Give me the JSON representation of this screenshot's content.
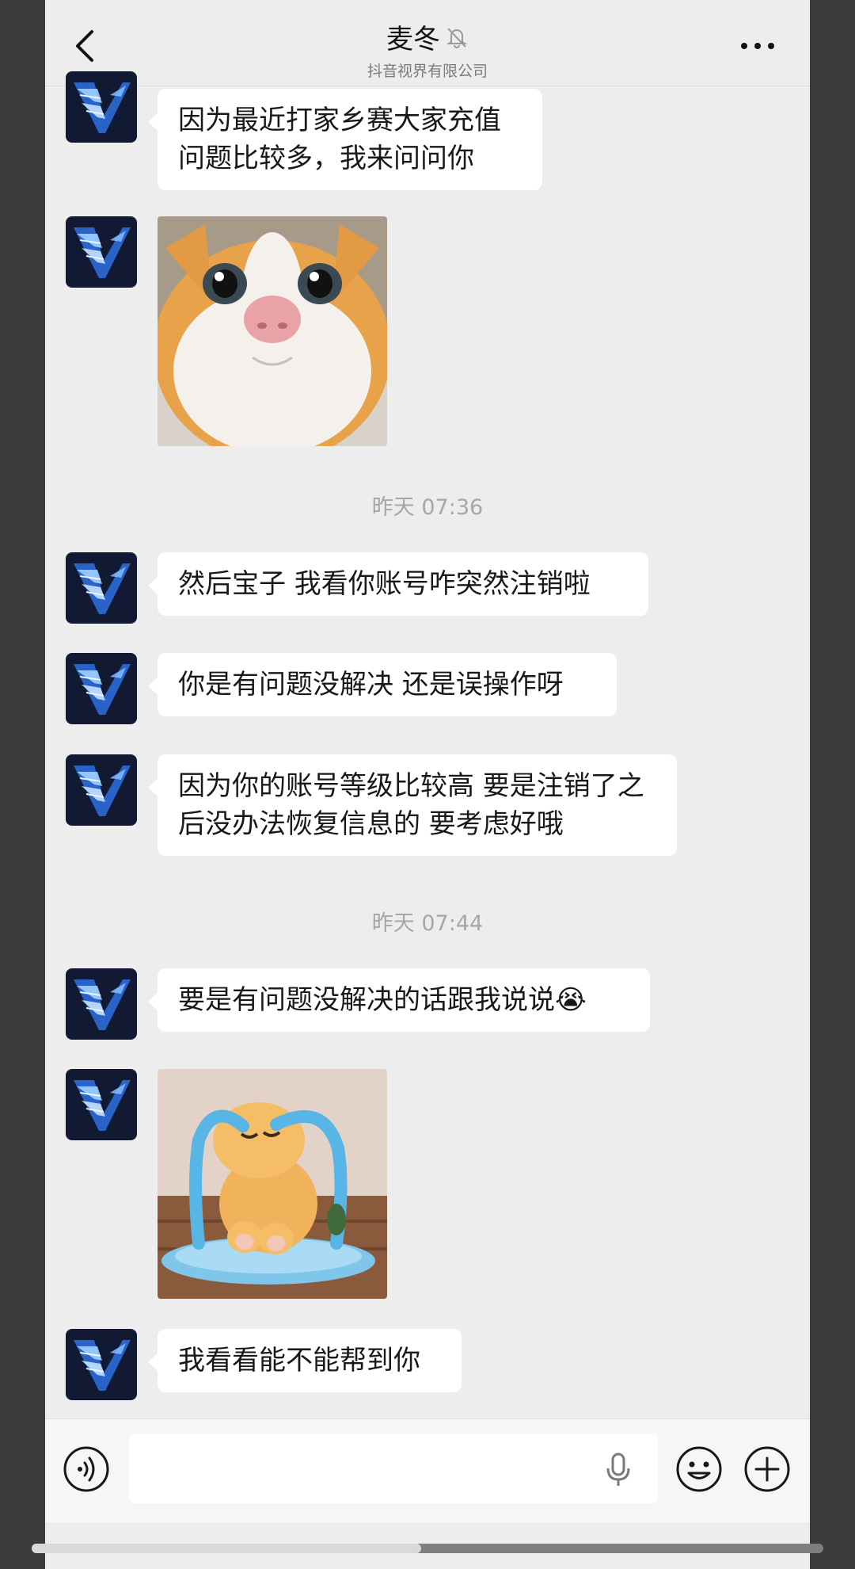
{
  "header": {
    "title": "麦冬",
    "subtitle": "抖音视界有限公司",
    "muted": true
  },
  "messages": [
    {
      "type": "text",
      "text": "因为最近打家乡赛大家充值问题比较多，我来问问你"
    },
    {
      "type": "sticker",
      "sticker": "cat-face"
    },
    {
      "type": "time",
      "text": "昨天 07:36"
    },
    {
      "type": "text",
      "text": "然后宝子 我看你账号咋突然注销啦"
    },
    {
      "type": "text",
      "text": "你是有问题没解决 还是误操作呀"
    },
    {
      "type": "text",
      "text": "因为你的账号等级比较高 要是注销了之后没办法恢复信息的 要考虑好哦"
    },
    {
      "type": "time",
      "text": "昨天 07:44"
    },
    {
      "type": "text",
      "text": "要是有问题没解决的话跟我说说😭"
    },
    {
      "type": "sticker",
      "sticker": "crying-plush"
    },
    {
      "type": "text",
      "text": "我看看能不能帮到你"
    }
  ],
  "input": {
    "value": "",
    "placeholder": ""
  },
  "colors": {
    "background": "#ededed",
    "bubble": "#ffffff",
    "avatar": "#121a33",
    "timestamp": "#a6a6a6"
  },
  "icons": [
    "back-icon",
    "bell-off-icon",
    "more-icon",
    "voice-icon",
    "mic-icon",
    "emoji-icon",
    "plus-icon"
  ]
}
